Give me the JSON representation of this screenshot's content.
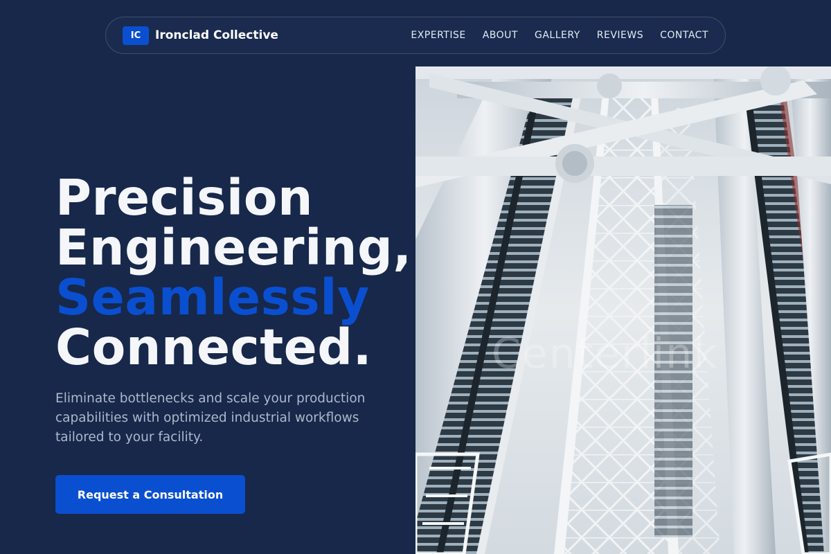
{
  "brand": {
    "mark": "IC",
    "name": "Ironclad Collective"
  },
  "nav": {
    "links": [
      "EXPERTISE",
      "ABOUT",
      "GALLERY",
      "REVIEWS",
      "CONTACT"
    ]
  },
  "hero": {
    "title_line1": "Precision",
    "title_line2": "Engineering,",
    "title_accent": "Seamlessly",
    "title_line4": "Connected.",
    "subtitle": "Eliminate bottlenecks and scale your production capabilities with optimized industrial workflows tailored to your facility.",
    "cta_label": "Request a Consultation",
    "image_watermark": "Centerlink"
  },
  "colors": {
    "background": "#17284a",
    "accent": "#0a4fd0",
    "heading": "#f4f6fa",
    "body_text": "#aeb8cc"
  }
}
